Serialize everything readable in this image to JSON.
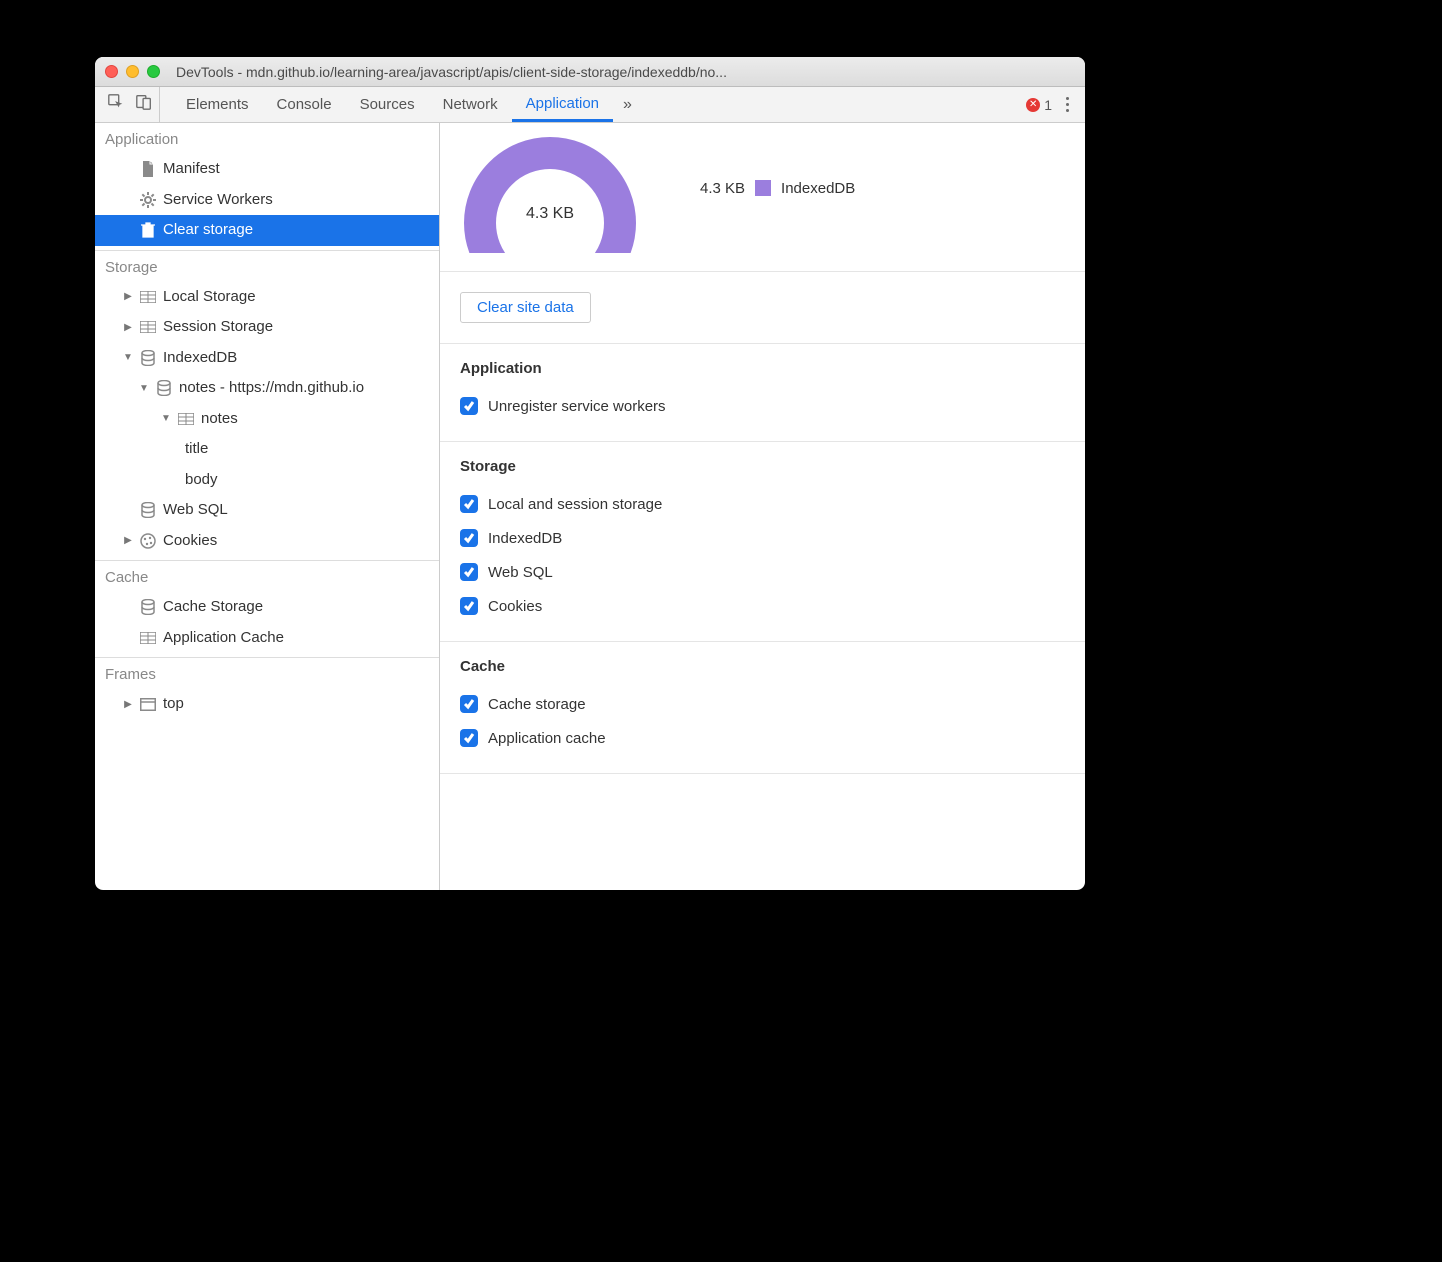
{
  "window": {
    "title": "DevTools - mdn.github.io/learning-area/javascript/apis/client-side-storage/indexeddb/no..."
  },
  "toolbar": {
    "tabs": [
      "Elements",
      "Console",
      "Sources",
      "Network",
      "Application"
    ],
    "error_count": "1"
  },
  "sidebar": {
    "groups": {
      "application": {
        "header": "Application",
        "manifest": "Manifest",
        "service_workers": "Service Workers",
        "clear_storage": "Clear storage"
      },
      "storage": {
        "header": "Storage",
        "local_storage": "Local Storage",
        "session_storage": "Session Storage",
        "indexeddb": "IndexedDB",
        "idb_db": "notes - https://mdn.github.io",
        "idb_store": "notes",
        "idb_field1": "title",
        "idb_field2": "body",
        "web_sql": "Web SQL",
        "cookies": "Cookies"
      },
      "cache": {
        "header": "Cache",
        "cache_storage": "Cache Storage",
        "application_cache": "Application Cache"
      },
      "frames": {
        "header": "Frames",
        "top": "top"
      }
    }
  },
  "main": {
    "donut_center": "4.3 KB",
    "legend_size": "4.3 KB",
    "legend_label": "IndexedDB",
    "legend_color": "#9b7ede",
    "clear_button": "Clear site data",
    "sections": {
      "application": {
        "title": "Application",
        "items": [
          "Unregister service workers"
        ]
      },
      "storage": {
        "title": "Storage",
        "items": [
          "Local and session storage",
          "IndexedDB",
          "Web SQL",
          "Cookies"
        ]
      },
      "cache": {
        "title": "Cache",
        "items": [
          "Cache storage",
          "Application cache"
        ]
      }
    }
  }
}
